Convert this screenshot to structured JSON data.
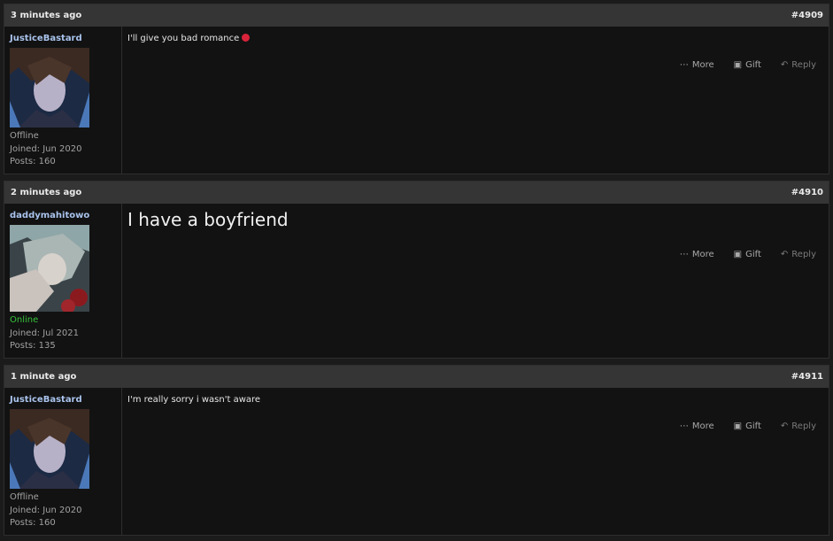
{
  "posts": [
    {
      "time": "3 minutes ago",
      "number": "#4909",
      "user": {
        "name": "JusticeBastard",
        "status": "Offline",
        "joined": "Joined: Jun 2020",
        "posts_count": "Posts: 160"
      },
      "message": "I'll give you bad romance",
      "actions": {
        "more": "More",
        "gift": "Gift",
        "reply": "Reply"
      }
    },
    {
      "time": "2 minutes ago",
      "number": "#4910",
      "user": {
        "name": "daddymahitowo",
        "status": "Online",
        "joined": "Joined: Jul 2021",
        "posts_count": "Posts: 135"
      },
      "message": "I have a boyfriend",
      "actions": {
        "more": "More",
        "gift": "Gift",
        "reply": "Reply"
      }
    },
    {
      "time": "1 minute ago",
      "number": "#4911",
      "user": {
        "name": "JusticeBastard",
        "status": "Offline",
        "joined": "Joined: Jun 2020",
        "posts_count": "Posts: 160"
      },
      "message": "I'm really sorry i wasn't aware",
      "actions": {
        "more": "More",
        "gift": "Gift",
        "reply": "Reply"
      }
    }
  ],
  "icons": {
    "more": "ellipsis-icon",
    "gift": "gift-icon",
    "reply": "reply-icon",
    "emoji": "devil-emoji-icon"
  },
  "colors": {
    "username": "#a9c3ec",
    "online": "#36c23a",
    "header_bg": "#353535",
    "body_bg": "#121212"
  }
}
